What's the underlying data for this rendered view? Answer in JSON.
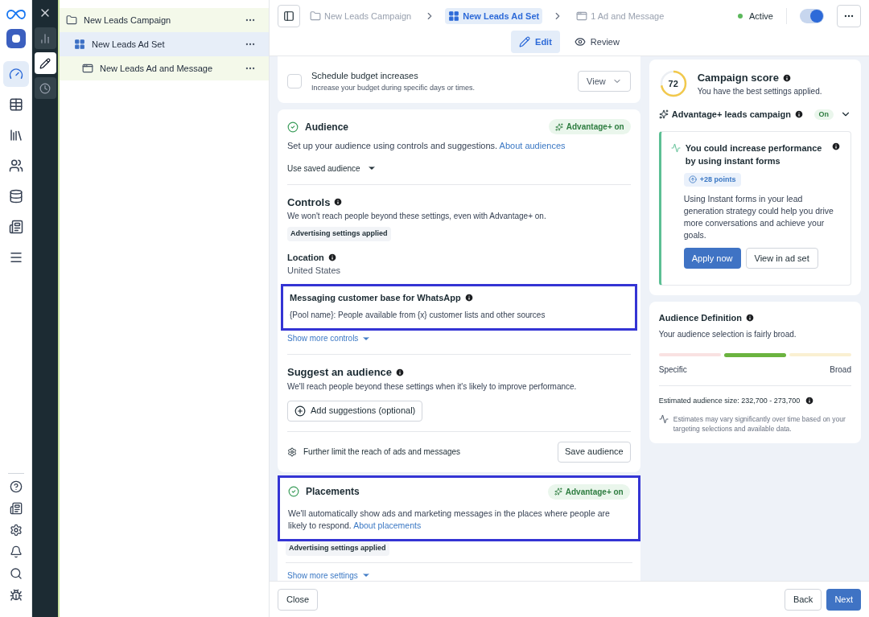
{
  "rail_items": [
    {
      "kind": "dashboard",
      "selected": true
    },
    {
      "kind": "table",
      "selected": false
    },
    {
      "kind": "pages",
      "selected": false
    },
    {
      "kind": "people",
      "selected": false
    },
    {
      "kind": "coins",
      "selected": false
    },
    {
      "kind": "catalog",
      "selected": false
    },
    {
      "kind": "menu",
      "selected": false
    }
  ],
  "rail_bottom": [
    {
      "kind": "help"
    },
    {
      "kind": "news"
    },
    {
      "kind": "settings"
    },
    {
      "kind": "bell"
    },
    {
      "kind": "search"
    },
    {
      "kind": "bug"
    }
  ],
  "tool_items": [
    {
      "kind": "chart",
      "selected": false
    },
    {
      "kind": "edit",
      "selected": true
    },
    {
      "kind": "history",
      "selected": false
    }
  ],
  "tree": [
    {
      "label": "New Leads Campaign",
      "kind": "campaign",
      "selected": false,
      "children": [
        {
          "label": "New Leads Ad Set",
          "kind": "adset",
          "selected": true,
          "children": [
            {
              "label": "New Leads Ad and Message",
              "kind": "ad",
              "selected": false
            }
          ]
        }
      ]
    }
  ],
  "breadcrumbs": [
    {
      "label": "New Leads Campaign",
      "kind": "campaign",
      "selected": false
    },
    {
      "label": "New Leads Ad Set",
      "kind": "adset",
      "selected": true
    },
    {
      "label": "1 Ad and Message",
      "kind": "ad",
      "selected": false
    }
  ],
  "status": {
    "label": "Active",
    "on": true
  },
  "mode_tabs": [
    {
      "label": "Edit",
      "kind": "edit",
      "selected": true
    },
    {
      "label": "Review",
      "kind": "review",
      "selected": false
    }
  ],
  "budget": {
    "checked": false,
    "title": "Schedule budget increases",
    "description": "Increase your budget during specific days or times.",
    "view": "View"
  },
  "audience": {
    "title": "Audience",
    "badge": "Advantage+ on",
    "description": "Set up your audience using controls and suggestions.",
    "link": "About audiences",
    "saved": "Use saved audience",
    "controls_title": "Controls",
    "controls_description": "We won't reach people beyond these settings, even with Advantage+ on.",
    "controls_tag": "Advertising settings applied",
    "location_title": "Location",
    "location_value": "United States",
    "messaging_title": "Messaging customer base for WhatsApp",
    "messaging_value": "{Pool name}: People available from {x} customer lists and other sources",
    "messaging_highlighted": true,
    "show_more": "Show more controls",
    "suggest_title": "Suggest an audience",
    "suggest_description": "We'll reach people beyond these settings when it's likely to improve performance.",
    "suggest_button": "Add suggestions (optional)",
    "limit": "Further limit the reach of ads and messages",
    "save": "Save audience"
  },
  "placements": {
    "title": "Placements",
    "badge": "Advantage+ on",
    "description": "We'll automatically show ads and marketing messages in the places where people are likely to respond.",
    "link": "About placements",
    "highlighted": true,
    "tag": "Advertising settings applied",
    "show_more": "Show more settings"
  },
  "score": {
    "value": "72",
    "title": "Campaign score",
    "subtitle": "You have the best settings applied.",
    "advantage": "Advantage+ leads campaign",
    "advantage_badge": "On",
    "expanded": true,
    "tip": {
      "title": "You could increase performance by using instant forms",
      "points": "+28 points",
      "body": "Using Instant forms in your lead generation strategy could help you drive more conversations and achieve your goals.",
      "primary": "Apply now",
      "secondary": "View in ad set"
    }
  },
  "definition": {
    "title": "Audience Definition",
    "subtitle": "Your audience selection is fairly broad.",
    "segments": [
      {
        "color": "#f9e2e2",
        "selected": false
      },
      {
        "color": "#6bb33f",
        "selected": true
      },
      {
        "color": "#faf0d2",
        "selected": false
      }
    ],
    "low": "Specific",
    "high": "Broad",
    "size": "Estimated audience size: 232,700 - 273,700",
    "note": "Estimates may vary significantly over time based on your targeting selections and available data."
  },
  "footer": {
    "close": "Close",
    "back": "Back",
    "next": "Next"
  }
}
